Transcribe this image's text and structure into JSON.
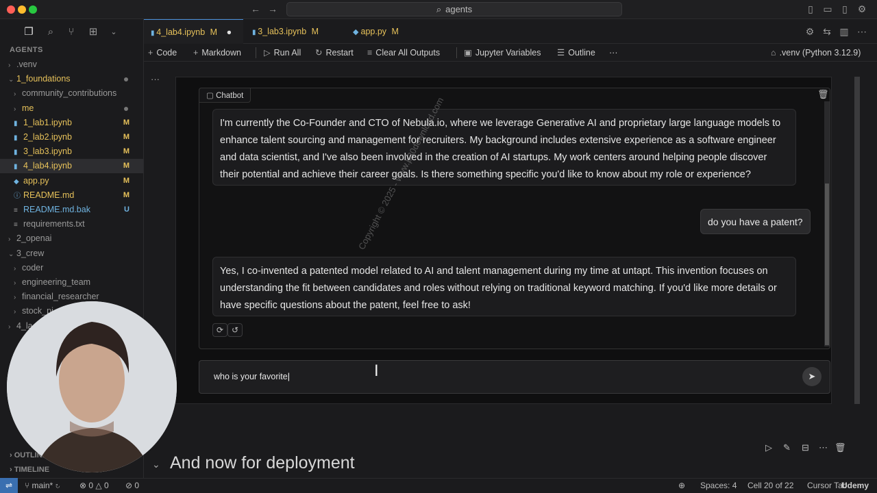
{
  "titlebar": {
    "search_text": "agents"
  },
  "explorer": {
    "title": "AGENTS",
    "items": [
      {
        "label": ".venv",
        "kind": "folder",
        "indent": 1,
        "open": false,
        "color": "#9a9a9a"
      },
      {
        "label": "1_foundations",
        "kind": "folder",
        "indent": 1,
        "open": true,
        "color": "#e6c15a",
        "dot": true
      },
      {
        "label": "community_contributions",
        "kind": "folder",
        "indent": 2,
        "open": false,
        "color": "#9a9a9a"
      },
      {
        "label": "me",
        "kind": "folder",
        "indent": 2,
        "open": false,
        "color": "#e6c15a",
        "dot": true
      },
      {
        "label": "1_lab1.ipynb",
        "kind": "nb",
        "indent": 2,
        "color": "#e6c15a",
        "badge": "M"
      },
      {
        "label": "2_lab2.ipynb",
        "kind": "nb",
        "indent": 2,
        "color": "#e6c15a",
        "badge": "M"
      },
      {
        "label": "3_lab3.ipynb",
        "kind": "nb",
        "indent": 2,
        "color": "#e6c15a",
        "badge": "M"
      },
      {
        "label": "4_lab4.ipynb",
        "kind": "nb",
        "indent": 2,
        "color": "#e6c15a",
        "badge": "M",
        "selected": true
      },
      {
        "label": "app.py",
        "kind": "py",
        "indent": 2,
        "color": "#e6c15a",
        "badge": "M"
      },
      {
        "label": "README.md",
        "kind": "info",
        "indent": 2,
        "color": "#e6c15a",
        "badge": "M"
      },
      {
        "label": "README.md.bak",
        "kind": "txt",
        "indent": 2,
        "color": "#6fb3e0",
        "badge": "U"
      },
      {
        "label": "requirements.txt",
        "kind": "txt",
        "indent": 2,
        "color": "#9a9a9a"
      },
      {
        "label": "2_openai",
        "kind": "folder",
        "indent": 1,
        "open": false,
        "color": "#9a9a9a"
      },
      {
        "label": "3_crew",
        "kind": "folder",
        "indent": 1,
        "open": true,
        "color": "#9a9a9a"
      },
      {
        "label": "coder",
        "kind": "folder",
        "indent": 2,
        "open": false,
        "color": "#9a9a9a"
      },
      {
        "label": "engineering_team",
        "kind": "folder",
        "indent": 2,
        "open": false,
        "color": "#9a9a9a"
      },
      {
        "label": "financial_researcher",
        "kind": "folder",
        "indent": 2,
        "open": false,
        "color": "#9a9a9a"
      },
      {
        "label": "stock_pi",
        "kind": "folder",
        "indent": 2,
        "open": false,
        "color": "#9a9a9a"
      },
      {
        "label": "4_la",
        "kind": "folder",
        "indent": 1,
        "open": false,
        "color": "#9a9a9a"
      }
    ],
    "outline_label": "OUTLINE",
    "timeline_label": "TIMELINE"
  },
  "tabs": [
    {
      "label": "4_lab4.ipynb",
      "badge": "M",
      "active": true
    },
    {
      "label": "3_lab3.ipynb",
      "badge": "M",
      "active": false
    },
    {
      "label": "app.py",
      "badge": "M",
      "active": false
    }
  ],
  "toolbar": {
    "code": "Code",
    "markdown": "Markdown",
    "run_all": "Run All",
    "restart": "Restart",
    "clear_outputs": "Clear All Outputs",
    "variables": "Jupyter Variables",
    "outline": "Outline",
    "more": "···",
    "kernel": ".venv (Python 3.12.9)"
  },
  "cell": {
    "ellipsis": "···"
  },
  "chat": {
    "label": "Chatbot",
    "bot_message_1": "I'm currently the Co-Founder and CTO of Nebula.io, where we leverage Generative AI and proprietary large language models to enhance talent sourcing and management for recruiters. My background includes extensive experience as a software engineer and data scientist, and I've also been involved in the creation of AI startups. My work centers around helping people discover their potential and achieve their career goals. Is there something specific you'd like to know about my role or experience?",
    "user_message": "do you have a patent?",
    "bot_message_2": "Yes, I co-invented a patented model related to AI and talent management during my time at untapt. This invention focuses on understanding the fit between candidates and roles without relying on traditional keyword matching. If you'd like more details or have specific questions about the patent, feel free to ask!",
    "input_value": "who is your favorite"
  },
  "watermark": "Copyright © 2025 - www.p30download.com",
  "next_heading": "And now for deployment",
  "statusbar": {
    "branch": "main*",
    "errors": "0",
    "warnings": "0",
    "ports": "0",
    "spaces": "Spaces: 4",
    "cell": "Cell 20 of 22",
    "cursor": "Cursor Tab",
    "brand": "Udemy"
  },
  "colors": {
    "accent": "#4a90d9",
    "modified": "#e6c15a",
    "untracked": "#6fb3e0"
  }
}
